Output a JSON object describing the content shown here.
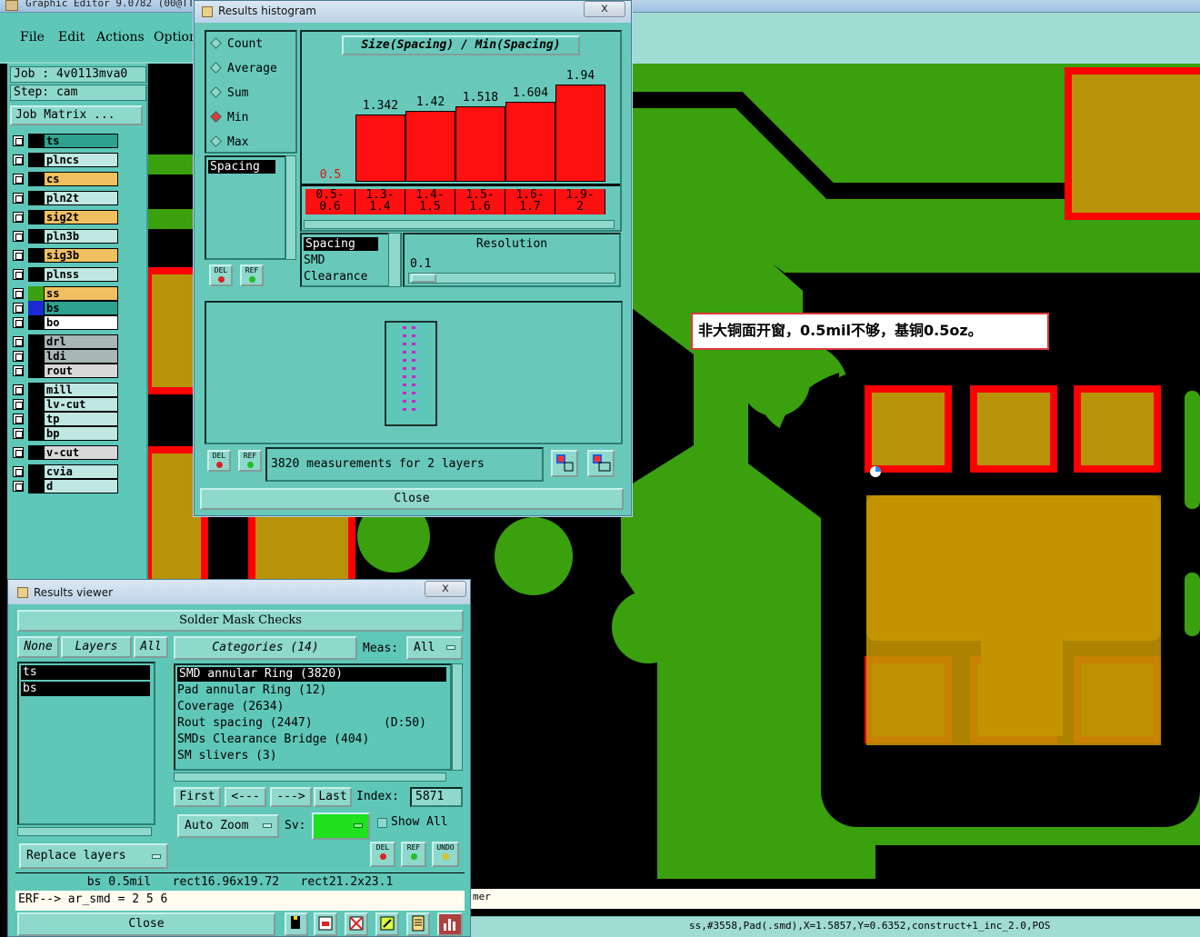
{
  "app": {
    "title": "Graphic Editor 9.0782 (00@TT"
  },
  "menu": {
    "file": "File",
    "edit": "Edit",
    "actions": "Actions",
    "options": "Option"
  },
  "job": {
    "job_line": "Job : 4v0113mva0",
    "step_line": "Step: cam",
    "matrix_button": "Job Matrix ..."
  },
  "layers": [
    {
      "name": "ts",
      "color": "#2ea28e"
    },
    {
      "name": "plncs",
      "color": "#bfe8e1"
    },
    {
      "name": "cs",
      "color": "#f0c060"
    },
    {
      "name": "pln2t",
      "color": "#bfe8e1"
    },
    {
      "name": "sig2t",
      "color": "#f0c060"
    },
    {
      "name": "pln3b",
      "color": "#bfe8e1"
    },
    {
      "name": "sig3b",
      "color": "#f0c060"
    },
    {
      "name": "plnss",
      "color": "#bfe8e1"
    },
    {
      "name": "ss",
      "color": "#f0c060"
    },
    {
      "name": "bs",
      "color": "#2ea28e"
    },
    {
      "name": "bo",
      "color": "#ffffff"
    },
    {
      "name": "drl",
      "color": "#a9b6b6"
    },
    {
      "name": "ldi",
      "color": "#a9b6b6"
    },
    {
      "name": "rout",
      "color": "#d8d8d8"
    },
    {
      "name": "mill",
      "color": "#bfe8e1"
    },
    {
      "name": "lv-cut",
      "color": "#bfe8e1"
    },
    {
      "name": "tp",
      "color": "#bfe8e1"
    },
    {
      "name": "bp",
      "color": "#bfe8e1"
    },
    {
      "name": "v-cut",
      "color": "#d8d8d8"
    },
    {
      "name": "cvia",
      "color": "#bfe8e1"
    },
    {
      "name": "d",
      "color": "#bfe8e1"
    }
  ],
  "histogram": {
    "window_title": "Results histogram",
    "close_x": "x",
    "radio_options": [
      "Count",
      "Average",
      "Sum",
      "Min",
      "Max"
    ],
    "selected_radio": "Min",
    "left_list_selected": "Spacing",
    "del_label": "DEL",
    "ref_label": "REF",
    "chart_title": "Size(Spacing) / Min(Spacing)",
    "category_list": [
      "Spacing",
      "SMD",
      "Clearance"
    ],
    "resolution_label": "Resolution",
    "resolution_value": "0.1",
    "measurements_text": "3820 measurements for 2 layers",
    "close_button": "Close"
  },
  "chart_data": {
    "type": "bar",
    "title": "Size(Spacing) / Min(Spacing)",
    "categories": [
      "0.5-0.6",
      "1.3-1.4",
      "1.4-1.5",
      "1.5-1.6",
      "1.6-1.7",
      "1.9-2"
    ],
    "category_lines": [
      [
        "0.5-",
        "0.6"
      ],
      [
        "1.3-",
        "1.4"
      ],
      [
        "1.4-",
        "1.5"
      ],
      [
        "1.5-",
        "1.6"
      ],
      [
        "1.6-",
        "1.7"
      ],
      [
        "1.9-",
        "2"
      ]
    ],
    "values": [
      0.5,
      1.342,
      1.42,
      1.518,
      1.604,
      1.94
    ],
    "value_labels": [
      "0.5",
      "1.342",
      "1.42",
      "1.518",
      "1.604",
      "1.94"
    ],
    "bar_color": "#ff1010",
    "ylim": [
      0,
      2.0
    ]
  },
  "note": {
    "text": "非大铜面开窗，0.5mil不够，基铜0.5oz。"
  },
  "viewer": {
    "window_title": "Results viewer",
    "close_x": "x",
    "header": "Solder Mask Checks",
    "none_btn": "None",
    "layers_btn": "Layers",
    "all_btn": "All",
    "layer_items": [
      "ts",
      "bs"
    ],
    "categories_btn": "Categories (14)",
    "meas_label": "Meas:",
    "meas_value": "All",
    "category_items": [
      "SMD annular Ring (3820)",
      "Pad annular Ring (12)",
      "Coverage (2634)",
      "Rout spacing (2447)          (D:50)",
      "SMDs Clearance Bridge (404)",
      "SM slivers (3)"
    ],
    "first_btn": "First",
    "prev_btn": "<---",
    "next_btn": "--->",
    "last_btn": "Last",
    "index_label": "Index:",
    "index_value": "5871",
    "zoom_btn": "Auto Zoom",
    "sv_label": "Sv:",
    "show_all": "Show All",
    "replace_btn": "Replace layers",
    "del_label": "DEL",
    "ref_label": "REF",
    "undo_label": "UNDO",
    "result_line": "bs 0.5mil   rect16.96x19.72   rect21.2x23.1",
    "erf_line": "ERF--> ar_smd = 2 5 6",
    "close_button": "Close"
  },
  "status": {
    "coords": "ss,#3558,Pad(.smd),X=1.5857,Y=0.6352,construct+1_inc_2.0,POS",
    "erf_suffix": "mer"
  }
}
